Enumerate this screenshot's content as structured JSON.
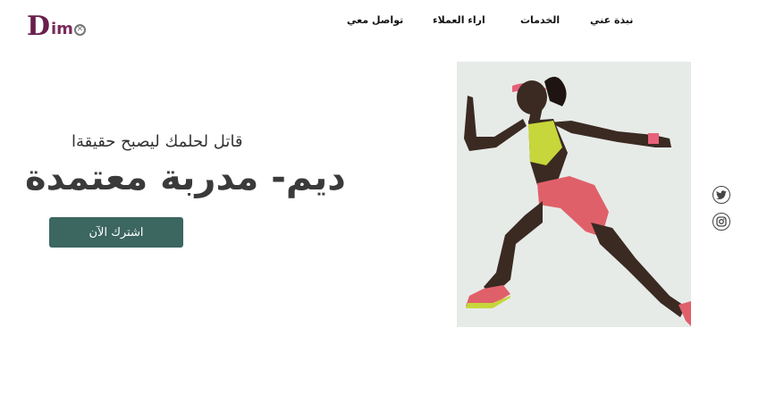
{
  "brand": {
    "logo_d": "D",
    "logo_rest": "im"
  },
  "nav": {
    "about": "نبذة عني",
    "services": "الخدمات",
    "testimonials": "اراء العملاء",
    "contact": "تواصل معي"
  },
  "hero": {
    "subtitle": "قاتل لحلمك ليصبح حقيقةا",
    "title": "ديم- مدربة معتمدة",
    "cta_label": "اشترك الآن"
  },
  "social": {
    "icons": [
      "twitter-icon",
      "instagram-icon"
    ]
  },
  "colors": {
    "cta_bg": "#3c6660",
    "photo_bg": "#e7ebe8",
    "logo_accent": "#6a1e4c",
    "top_color": "#c7d63a",
    "shorts_color": "#e0606a",
    "headband_color": "#e8607a",
    "skin_color": "#3a2a22"
  }
}
